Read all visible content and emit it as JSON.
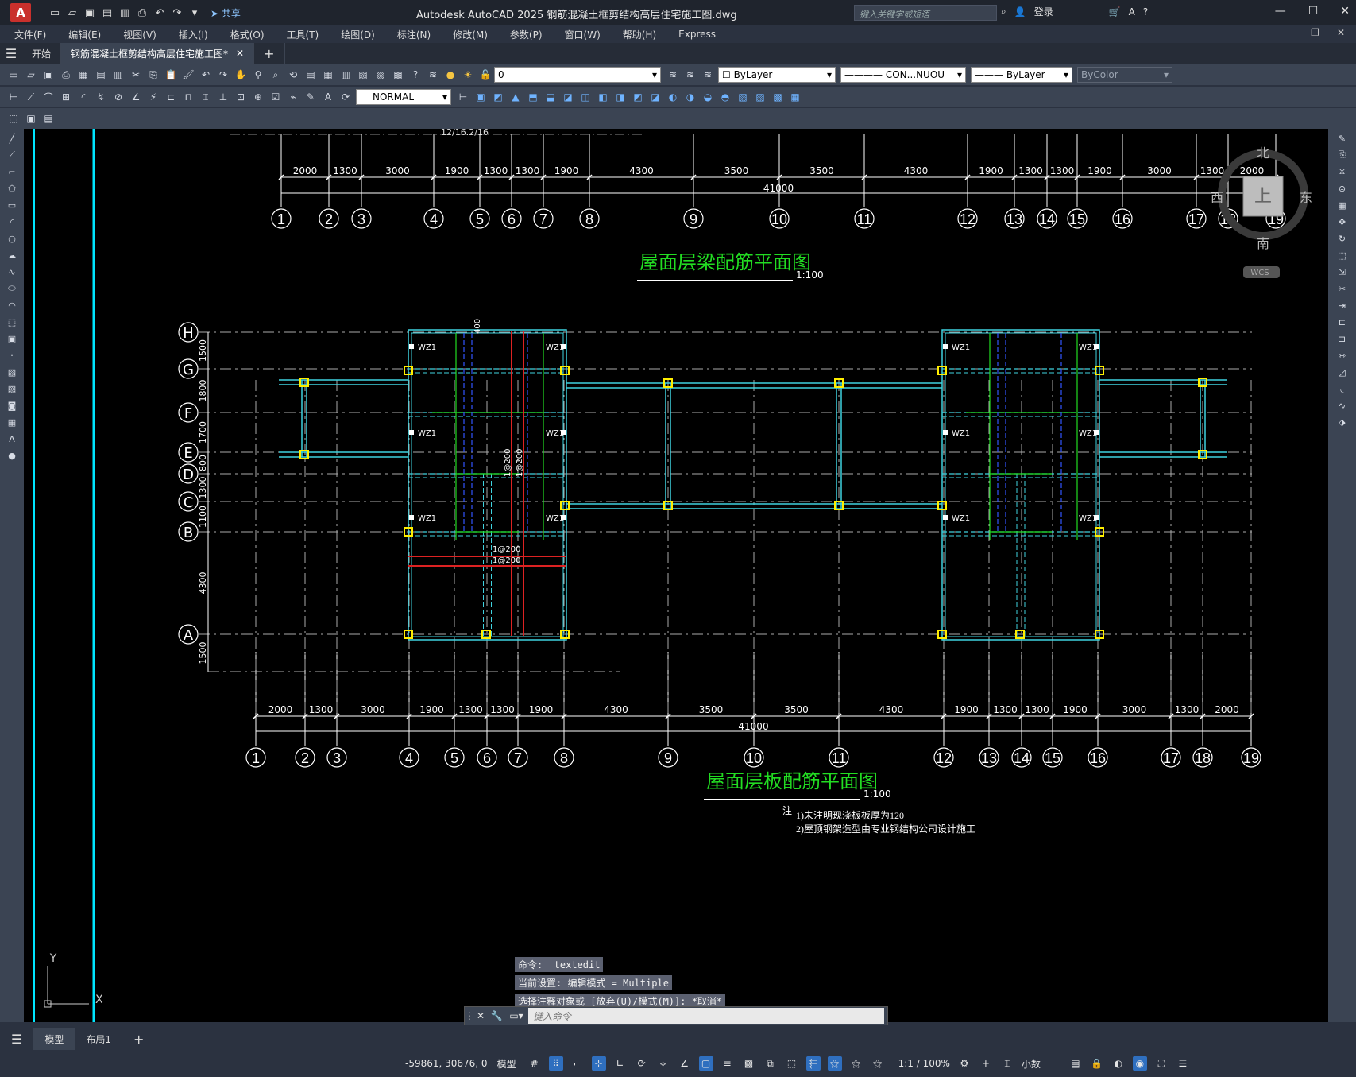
{
  "titlebar": {
    "logo": "A",
    "share": "共享",
    "title": "Autodesk AutoCAD 2025    钢筋混凝土框剪结构高层住宅施工图.dwg",
    "search_placeholder": "键入关键字或短语",
    "login": "登录",
    "qat_icons": [
      "new-icon",
      "open-icon",
      "save-icon",
      "saveas-icon",
      "publish-icon",
      "plot-icon",
      "undo-icon",
      "redo-icon",
      "share-icon"
    ]
  },
  "menu": [
    "文件(F)",
    "编辑(E)",
    "视图(V)",
    "插入(I)",
    "格式(O)",
    "工具(T)",
    "绘图(D)",
    "标注(N)",
    "修改(M)",
    "参数(P)",
    "窗口(W)",
    "帮助(H)",
    "Express"
  ],
  "tabs": {
    "start": "开始",
    "doc": "钢筋混凝土框剪结构高层住宅施工图*",
    "add": "+"
  },
  "toolbar": {
    "layer": "0",
    "color": "ByLayer",
    "linetype": "CON...NUOU",
    "lineweight": "ByLayer",
    "plotstyle": "ByColor",
    "dimstyle": "NORMAL"
  },
  "drawing": {
    "title_top": "屋面层梁配筋平面图",
    "scale_top": "1:100",
    "title_bottom": "屋面层板配筋平面图",
    "scale_bottom": "1:100",
    "notes_prefix": "注",
    "notes": [
      "1)未注明现浇板板厚为120",
      "2)屋顶钢架造型由专业钢结构公司设计施工"
    ],
    "top_fragment": "12/16.2/16",
    "axes": [
      "1",
      "2",
      "3",
      "4",
      "5",
      "6",
      "7",
      "8",
      "9",
      "10",
      "11",
      "12",
      "13",
      "14",
      "15",
      "16",
      "17",
      "18",
      "19"
    ],
    "dims": [
      "2000",
      "1300",
      "3000",
      "1900",
      "1300",
      "1300",
      "1900",
      "4300",
      "3500",
      "3500",
      "4300",
      "1900",
      "1300",
      "1300",
      "1900",
      "3000",
      "1300",
      "2000"
    ],
    "total": "41000",
    "rows": [
      "H",
      "G",
      "F",
      "E",
      "D",
      "C",
      "B",
      "A"
    ],
    "row_dims": [
      "1500",
      "1800",
      "1700",
      "800",
      "1300",
      "1100",
      "4300",
      "1500"
    ],
    "wz": "WZ1",
    "rebar_labels": [
      "1@200",
      "1@200",
      "1@200",
      "1@200"
    ],
    "dim_400": "400"
  },
  "viewcube": {
    "north": "北",
    "south": "南",
    "east": "东",
    "west": "西",
    "top": "上",
    "wcs": "WCS"
  },
  "ucs": {
    "x": "X",
    "y": "Y"
  },
  "command": {
    "lines": [
      "命令: _textedit",
      "当前设置: 编辑模式 = Multiple",
      "选择注释对象或 [放弃(U)/模式(M)]: *取消*"
    ],
    "placeholder": "键入命令"
  },
  "layouts": [
    "模型",
    "布局1"
  ],
  "status": {
    "coords": "-59861, 30676, 0",
    "model": "模型",
    "scale": "1:1 / 100%",
    "units": "小数"
  }
}
